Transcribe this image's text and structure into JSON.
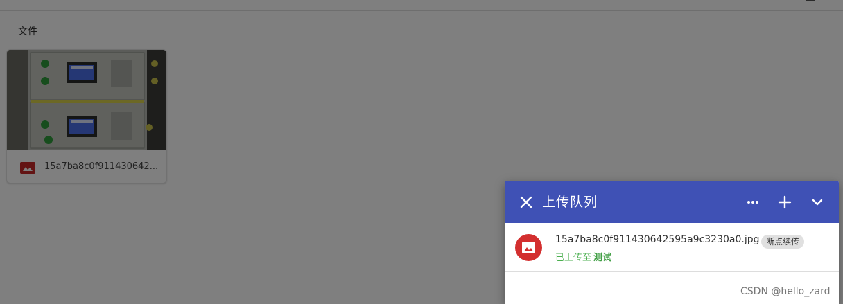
{
  "files_section": {
    "label": "文件",
    "cards": [
      {
        "name": "15a7ba8c0f911430642...",
        "icon": "image-file-icon",
        "thumbnail": "electrical-cabinet-photo"
      }
    ]
  },
  "upload_queue": {
    "title": "上传队列",
    "header_color": "#3f51b5",
    "buttons": {
      "close": "close-icon",
      "more": "more-horizontal-icon",
      "add": "plus-icon",
      "collapse": "chevron-down-icon"
    },
    "items": [
      {
        "file_name": "15a7ba8c0f911430642595a9c3230a0.jpg",
        "badge": "断点续传",
        "status_prefix": "已上传至",
        "destination": "测试",
        "icon": "image-icon",
        "icon_color": "#d32f2f",
        "status_color": "#4caf50"
      }
    ]
  },
  "watermark": "CSDN @hello_zard"
}
